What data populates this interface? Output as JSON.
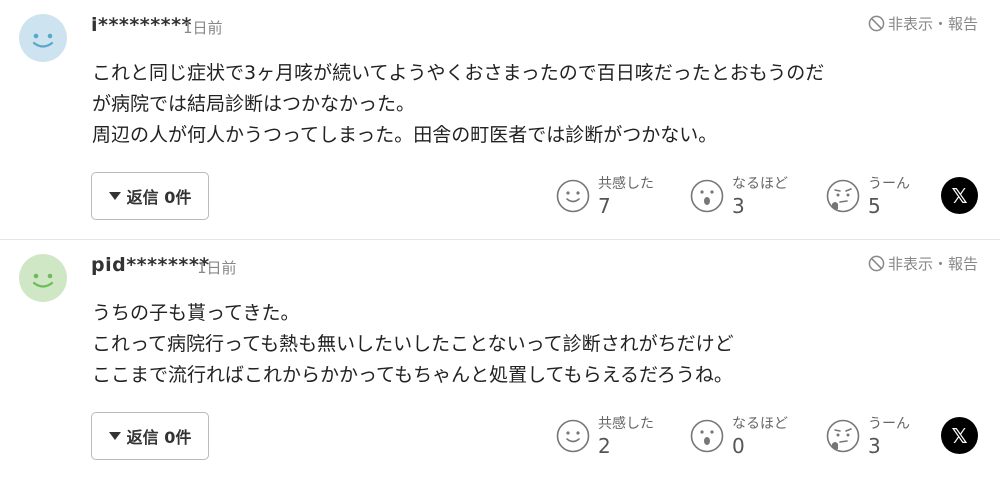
{
  "colors": {
    "avatar1": "#cde3f0",
    "avatar2": "#cfe7c4",
    "x_button": "#000000"
  },
  "comments": [
    {
      "username": "i*********",
      "time": "1日前",
      "report_label": "非表示・報告",
      "lines": [
        "これと同じ症状で3ヶ月咳が続いてようやくおさまったので百日咳だったとおもうのだ",
        "が病院では結局診断はつかなかった。",
        "周辺の人が何人かうつってしまった。田舎の町医者では診断がつかない。"
      ],
      "reply_label": "返信 0件",
      "reactions": [
        {
          "label": "共感した",
          "count": "7",
          "icon": "smile-face-icon"
        },
        {
          "label": "なるほど",
          "count": "3",
          "icon": "surprised-face-icon"
        },
        {
          "label": "うーん",
          "count": "5",
          "icon": "thinking-face-icon"
        }
      ],
      "share_icon": "x-logo-icon"
    },
    {
      "username": "pid********",
      "time": "1日前",
      "report_label": "非表示・報告",
      "lines": [
        "うちの子も貰ってきた。",
        "これって病院行っても熱も無いしたいしたことないって診断されがちだけど",
        "ここまで流行ればこれからかかってもちゃんと処置してもらえるだろうね。"
      ],
      "reply_label": "返信 0件",
      "reactions": [
        {
          "label": "共感した",
          "count": "2",
          "icon": "smile-face-icon"
        },
        {
          "label": "なるほど",
          "count": "0",
          "icon": "surprised-face-icon"
        },
        {
          "label": "うーん",
          "count": "3",
          "icon": "thinking-face-icon"
        }
      ],
      "share_icon": "x-logo-icon"
    }
  ]
}
